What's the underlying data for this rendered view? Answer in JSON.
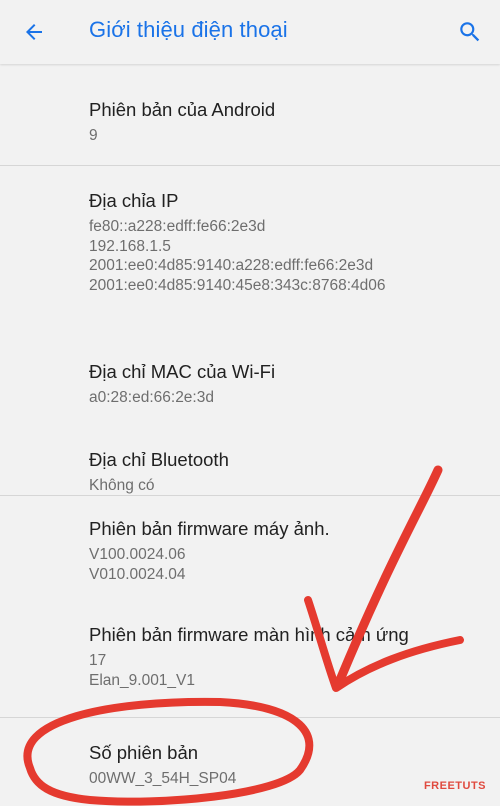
{
  "app_bar": {
    "title": "Giới thiệu điện thoại",
    "back_icon": "arrow-back-icon",
    "search_icon": "search-icon"
  },
  "items": [
    {
      "title": "Phiên bản của Android",
      "lines": [
        "9"
      ]
    },
    {
      "title": "Địa chỉa IP",
      "lines": [
        "fe80::a228:edff:fe66:2e3d",
        "192.168.1.5",
        "2001:ee0:4d85:9140:a228:edff:fe66:2e3d",
        "2001:ee0:4d85:9140:45e8:343c:8768:4d06"
      ]
    },
    {
      "title": "Địa chỉ MAC của Wi-Fi",
      "lines": [
        "a0:28:ed:66:2e:3d"
      ]
    },
    {
      "title": "Địa chỉ Bluetooth",
      "lines": [
        "Không có"
      ]
    },
    {
      "title": "Phiên bản firmware máy ảnh.",
      "lines": [
        "V100.0024.06",
        "V010.0024.04"
      ]
    },
    {
      "title": "Phiên bản firmware màn hình cảm ứng",
      "lines": [
        "17",
        "Elan_9.001_V1"
      ]
    },
    {
      "title": "Số phiên bản",
      "lines": [
        "00WW_3_54H_SP04"
      ]
    }
  ],
  "watermark": "FREETUTS",
  "colors": {
    "accent": "#1a73e8",
    "background": "#f2f2f2",
    "annotation": "#e53a2f",
    "secondary_text": "#6e6e6e"
  }
}
